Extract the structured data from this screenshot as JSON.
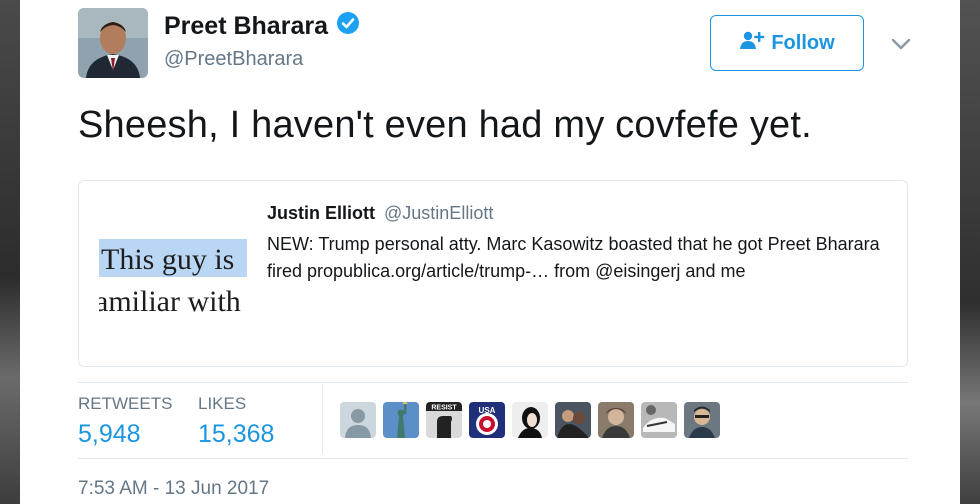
{
  "author": {
    "name": "Preet Bharara",
    "handle": "@PreetBharara",
    "verified": true
  },
  "follow_button": {
    "label": "Follow",
    "icon": "add-user-icon",
    "color": "#1b95e0"
  },
  "tweet": {
    "text": "Sheesh, I haven't even had my covfefe yet."
  },
  "quoted_tweet": {
    "author_name": "Justin Elliott",
    "author_handle": "@JustinElliott",
    "text": "NEW: Trump personal atty. Marc Kasowitz boasted that he got Preet Bharara fired propublica.org/article/trump-… from @eisingerj and me",
    "image_text_line1": "This guy is",
    "image_text_line2": "amiliar with"
  },
  "stats": {
    "retweets_label": "RETWEETS",
    "retweets_value": "5,948",
    "likes_label": "LIKES",
    "likes_value": "15,368"
  },
  "liker_avatars": [
    "default-avatar",
    "statue-of-liberty",
    "resist-fist",
    "usa-flag",
    "portrait-1",
    "portrait-2",
    "portrait-3",
    "sneakers",
    "portrait-4"
  ],
  "timestamp": "7:53 AM - 13 Jun 2017",
  "colors": {
    "link": "#1b95e0",
    "text": "#14171a",
    "muted": "#657786",
    "border": "#e1e8ed"
  }
}
